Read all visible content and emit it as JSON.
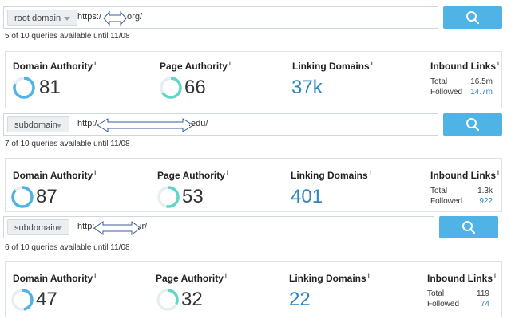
{
  "blocks": [
    {
      "select_label": "root domain",
      "url_prefix": "https:/",
      "url_suffix": ".org/",
      "quota": "5 of 10 queries available until 11/08",
      "domain_authority": {
        "title": "Domain Authority",
        "value": "81",
        "fraction": 0.81
      },
      "page_authority": {
        "title": "Page Authority",
        "value": "66",
        "fraction": 0.66
      },
      "linking_domains": {
        "title": "Linking Domains",
        "value": "37k"
      },
      "inbound_links": {
        "title": "Inbound Links",
        "total_label": "Total",
        "total": "16.5m",
        "followed_label": "Followed",
        "followed": "14.7m"
      }
    },
    {
      "select_label": "subdomain",
      "url_prefix": "http:/",
      "url_suffix": ".edu/",
      "quota": "7 of 10 queries available until 11/08",
      "domain_authority": {
        "title": "Domain Authority",
        "value": "87",
        "fraction": 0.87
      },
      "page_authority": {
        "title": "Page Authority",
        "value": "53",
        "fraction": 0.53
      },
      "linking_domains": {
        "title": "Linking Domains",
        "value": "401"
      },
      "inbound_links": {
        "title": "Inbound Links",
        "total_label": "Total",
        "total": "1.3k",
        "followed_label": "Followed",
        "followed": "922"
      }
    },
    {
      "select_label": "subdomain",
      "url_prefix": "http:",
      "url_suffix": ".ir/",
      "quota": "6 of 10 queries available until 11/08",
      "domain_authority": {
        "title": "Domain Authority",
        "value": "47",
        "fraction": 0.47
      },
      "page_authority": {
        "title": "Page Authority",
        "value": "32",
        "fraction": 0.32
      },
      "linking_domains": {
        "title": "Linking Domains",
        "value": "22"
      },
      "inbound_links": {
        "title": "Inbound Links",
        "total_label": "Total",
        "total": "119",
        "followed_label": "Followed",
        "followed": "74"
      }
    }
  ],
  "info_mark": "i",
  "colors": {
    "ring_domain": "#4fb3e6",
    "ring_page": "#5fd6c6",
    "ring_track": "#e6eef2",
    "button": "#4fb3e6",
    "link_value": "#2e86c1"
  },
  "icons": {
    "search": "search-icon",
    "dropdown": "chevron-down-icon"
  }
}
